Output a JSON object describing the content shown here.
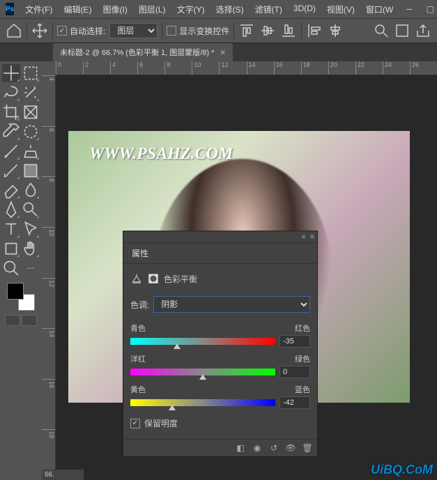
{
  "titlebar": {
    "app": "Ps",
    "menu": [
      "文件(F)",
      "编辑(E)",
      "图像(I)",
      "图层(L)",
      "文字(Y)",
      "选择(S)",
      "滤镜(T)",
      "3D(D)",
      "视图(V)",
      "窗口(W"
    ]
  },
  "options": {
    "auto_select": "自动选择:",
    "layer_option": "图层",
    "show_transform": "显示变换控件"
  },
  "doc_tab": {
    "title": "未标题-2 @ 66.7% (色彩平衡 1, 图层蒙版/8) *"
  },
  "ruler_h": [
    "0",
    "2",
    "4",
    "6",
    "8",
    "10",
    "12",
    "14",
    "16",
    "18",
    "20",
    "22",
    "24",
    "26"
  ],
  "ruler_v": [
    "4",
    "6",
    "8",
    "10",
    "12",
    "14",
    "16",
    "18"
  ],
  "canvas": {
    "watermark": "WWW.PSAHZ.COM"
  },
  "zoom": "66.",
  "panel": {
    "title": "属性",
    "adj_name": "色彩平衡",
    "tone_label": "色调:",
    "tone_value": "阴影",
    "sliders": {
      "cr": {
        "left": "青色",
        "right": "红色",
        "value": "-35",
        "thumb": 32
      },
      "mg": {
        "left": "洋红",
        "right": "绿色",
        "value": "0",
        "thumb": 50
      },
      "yb": {
        "left": "黄色",
        "right": "蓝色",
        "value": "-42",
        "thumb": 29
      }
    },
    "preserve": "保留明度"
  },
  "footer_watermark": "UiBQ.CoM"
}
